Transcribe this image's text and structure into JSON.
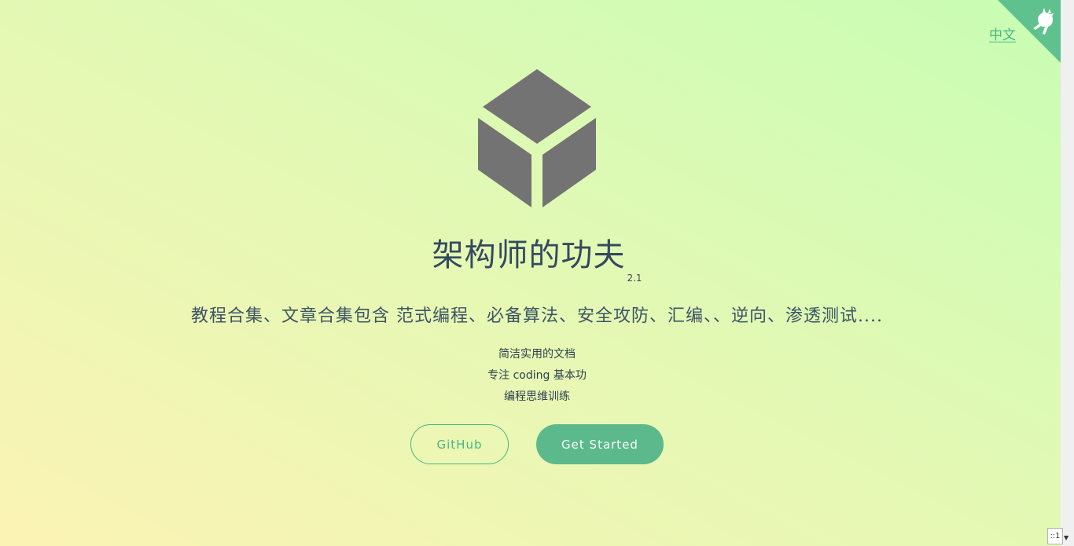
{
  "header": {
    "lang_link": "中文"
  },
  "cover": {
    "title": "架构师的功夫",
    "version": "2.1",
    "tagline": "教程合集、文章合集包含 范式编程、必备算法、安全攻防、汇编、、逆向、渗透测试....",
    "features": [
      "简洁实用的文档",
      "专注 coding 基本功",
      "编程思维训练"
    ],
    "buttons": {
      "github": "GitHub",
      "start": "Get Started"
    }
  },
  "widget": {
    "label": "::1"
  },
  "colors": {
    "accent": "#42b983",
    "button_fill": "#5bb98b",
    "logo": "#737373",
    "corner": "#5fc18d",
    "text": "#34495e",
    "gradient_start": "#fbf3b4",
    "gradient_end": "#c8fdb4"
  },
  "icons": {
    "corner": "octocat-icon",
    "logo": "cube-icon"
  }
}
